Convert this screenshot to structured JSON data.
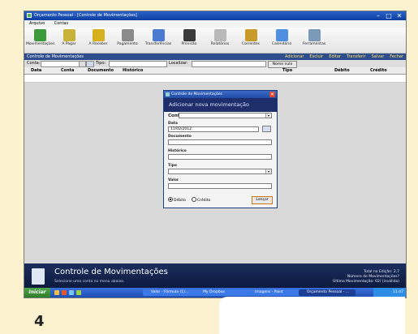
{
  "window": {
    "title": "Orçamento Pessoal - [Controle de Movimentações]"
  },
  "menu": [
    "Arquivo",
    "Contas"
  ],
  "toolbar": [
    {
      "label": "Movimentações",
      "icon": "heart-icon",
      "color": "#3c9a3a"
    },
    {
      "label": "A Pagar",
      "icon": "pen-icon",
      "color": "#c9b23a"
    },
    {
      "label": "A Receber",
      "icon": "coins-icon",
      "color": "#d7b020"
    },
    {
      "label": "Pagamento",
      "icon": "hand-icon",
      "color": "#8a8a8a"
    },
    {
      "label": "Transferências",
      "icon": "transfer-icon",
      "color": "#4a7bd0"
    },
    {
      "label": "Previsão",
      "icon": "monitor-icon",
      "color": "#3a3a3a"
    },
    {
      "label": "Relatórios",
      "icon": "report-icon",
      "color": "#b9b9b9"
    },
    {
      "label": "Correntes",
      "icon": "people-icon",
      "color": "#c79a2a"
    },
    {
      "label": "Calendário",
      "icon": "calendar-icon",
      "color": "#4f8fe0"
    },
    {
      "label": "Ferramentas",
      "icon": "tools-icon",
      "color": "#7a9ab8"
    }
  ],
  "subbar": {
    "title": "Controle de Movimentações",
    "actions": [
      "Adicionar",
      "Excluir",
      "Editar",
      "Transferir",
      "Salvar",
      "Fechar"
    ]
  },
  "filter": {
    "conta_label": "Conta:",
    "tipo_label": "Tipo:",
    "localizar_label": "Localizar:",
    "button": "Nome nulo"
  },
  "grid": {
    "columns": [
      "Data",
      "Conta",
      "Documento",
      "Histórico",
      "Tipo",
      "Débito",
      "Crédito"
    ]
  },
  "dialog": {
    "title": "Controle de Movimentações",
    "heading": "Adicionar nova movimentação",
    "conta_label": "Conta",
    "data_label": "Data",
    "data_value": "11/02/2012",
    "documento_label": "Documento",
    "historico_label": "Histórico",
    "tipo_label": "Tipo",
    "valor_label": "Valor",
    "radio_debito": "Débito",
    "radio_credito": "Crédito",
    "lancar": "Lançar"
  },
  "footer": {
    "title": "Controle de Movimentações",
    "subtitle": "Selecione uma conta no menu abaixo.",
    "stat1": "Total na Edição: 2,7",
    "stat2": "Número de Movimentações?",
    "stat3": "Última Movimentação: 02/ (inválida)"
  },
  "taskbar": {
    "start": "Iniciar",
    "tasks": [
      "Valor - Fórmula (1)...",
      "My Dropbox",
      "Imagens - Paint",
      "Orçamento Pessoal - ..."
    ],
    "clock": "11:47"
  },
  "step": "4"
}
